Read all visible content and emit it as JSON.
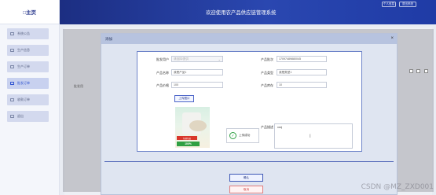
{
  "brand": "□主页",
  "header": {
    "title": "欢迎使用农产品供应链管理系统",
    "btn_user": "个人信息",
    "btn_exit": "退出系统"
  },
  "sidebar": {
    "items": [
      {
        "label": "系统公告",
        "active": false
      },
      {
        "label": "生产信息",
        "active": false
      },
      {
        "label": "生产订单",
        "active": false
      },
      {
        "label": "批发订单",
        "active": true
      },
      {
        "label": "收款订单",
        "active": false
      },
      {
        "label": "退出",
        "active": false
      }
    ]
  },
  "background": {
    "col_label": "批发用"
  },
  "dialog": {
    "title": "添加",
    "close": "×",
    "fields": {
      "wholesaler_label": "批发用户",
      "wholesaler_placeholder": "请选择/提供",
      "batch_label": "产品批次",
      "batch_value": "17097489880045",
      "name_label": "产品名称",
      "name_value": "我是产品1",
      "type_label": "产品类型",
      "type_value": "我是类型1",
      "price_label": "产品价格",
      "price_value": "100",
      "stock_label": "产品库存",
      "stock_value": "10",
      "desc_label": "产品描述",
      "desc_value": "xxx|"
    },
    "upload_label": "上传图片",
    "image": {
      "badge_red": "包邮包装",
      "badge_green": "100%"
    },
    "toast": "上传成功",
    "ok": "确认",
    "cancel": "取消"
  },
  "watermark": "CSDN @MZ_ZXD001",
  "colors": {
    "header": "#1f3ba6",
    "sidebar_active": "#2d52d1",
    "cancel": "#d14a4a",
    "success": "#2fa043"
  }
}
